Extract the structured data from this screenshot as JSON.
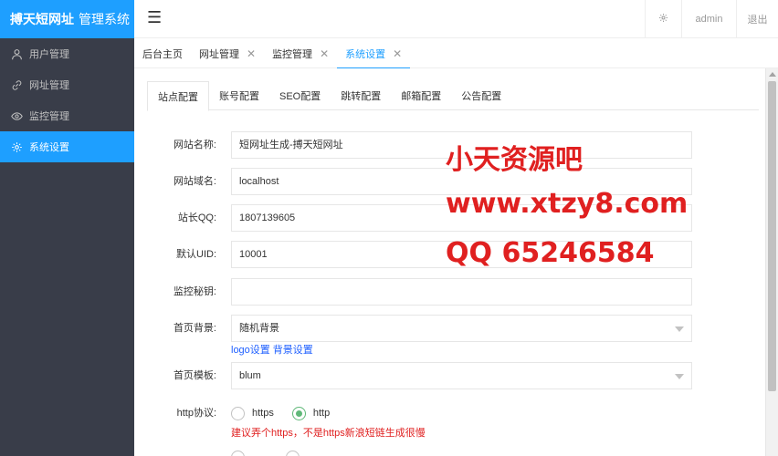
{
  "brand": {
    "bold": "搏天短网址",
    "rest": "管理系统"
  },
  "sidebar": {
    "items": [
      {
        "label": "用户管理",
        "icon": "user-icon"
      },
      {
        "label": "网址管理",
        "icon": "link-icon"
      },
      {
        "label": "监控管理",
        "icon": "eye-icon"
      },
      {
        "label": "系统设置",
        "icon": "gear-icon"
      }
    ],
    "active_index": 3
  },
  "header": {
    "menu_icon": "hamburger-icon",
    "gear_icon": "gear-icon",
    "admin": "admin",
    "logout": "退出"
  },
  "tabs": [
    {
      "label": "后台主页"
    },
    {
      "label": "网址管理"
    },
    {
      "label": "监控管理"
    },
    {
      "label": "系统设置"
    }
  ],
  "subtabs": [
    "站点配置",
    "账号配置",
    "SEO配置",
    "跳转配置",
    "邮箱配置",
    "公告配置"
  ],
  "form": {
    "site_name": {
      "label": "网站名称:",
      "value": "短网址生成-搏天短网址"
    },
    "site_domain": {
      "label": "网站域名:",
      "value": "localhost"
    },
    "qq": {
      "label": "站长QQ:",
      "value": "1807139605"
    },
    "uid": {
      "label": "默认UID:",
      "value": "10001"
    },
    "monitor_key": {
      "label": "监控秘钥:",
      "value": ""
    },
    "home_bg": {
      "label": "首页背景:",
      "value": "随机背景"
    },
    "bg_links": {
      "logo": "logo设置",
      "bg": "背景设置"
    },
    "home_template": {
      "label": "首页模板:",
      "value": "blum"
    },
    "http": {
      "label": "http协议:",
      "options": [
        "https",
        "http"
      ],
      "selected": "http",
      "hint": "建议弄个https，不是https新浪短链生成很慢"
    }
  },
  "watermark": {
    "line1": "小天资源吧",
    "line2": "www.xtzy8.com",
    "line3": "QQ 65246584"
  },
  "colors": {
    "accent": "#1e9fff",
    "sidebar_bg": "#393d49",
    "radio_checked": "#5fb878",
    "warning": "#e02020"
  }
}
